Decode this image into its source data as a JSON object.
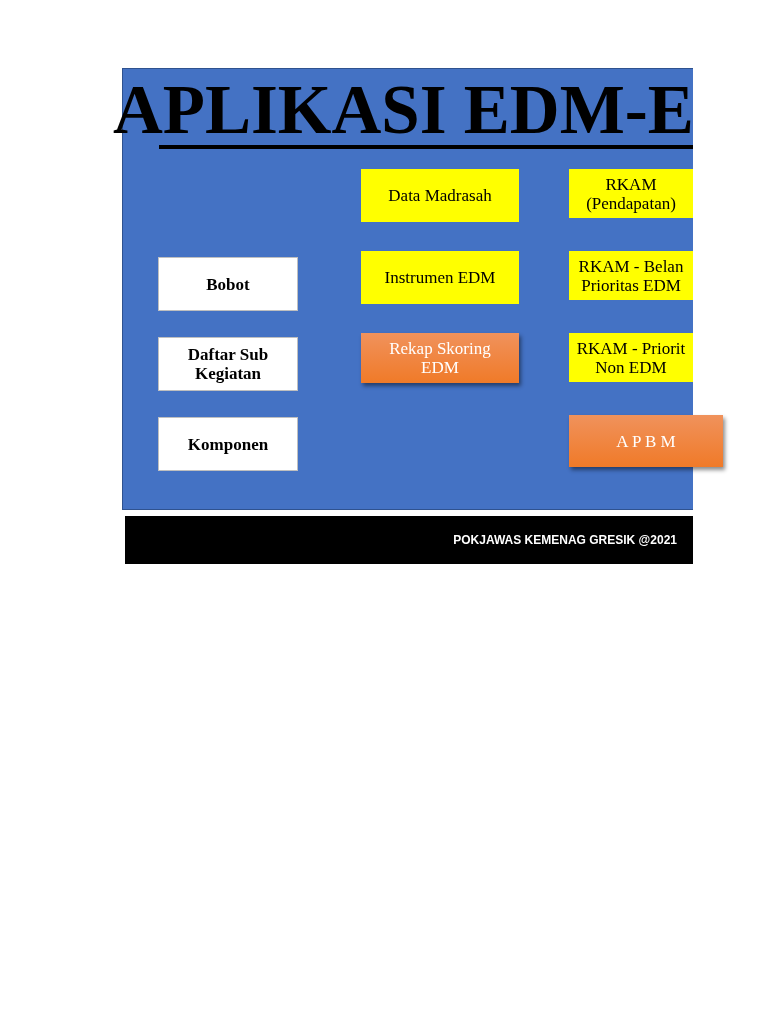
{
  "title": "APLIKASI EDM-E",
  "menu_columns": [
    {
      "items": [
        {
          "label": "Bobot",
          "kind": "plain"
        },
        {
          "label": "Daftar Sub Kegiatan",
          "kind": "plain"
        },
        {
          "label": "Komponen",
          "kind": "plain"
        }
      ]
    },
    {
      "items": [
        {
          "label": "Data Madrasah",
          "kind": "highlight"
        },
        {
          "label": "Instrumen EDM",
          "kind": "highlight"
        },
        {
          "label": "Rekap Skoring EDM",
          "kind": "accent"
        }
      ]
    },
    {
      "items": [
        {
          "label": "RKAM (Pendapatan)",
          "kind": "highlight"
        },
        {
          "label": "RKAM - Belan Prioritas EDM",
          "kind": "highlight"
        },
        {
          "label": "RKAM - Priorit Non EDM",
          "kind": "highlight"
        },
        {
          "label": "A P B M",
          "kind": "accent"
        }
      ]
    }
  ],
  "footer": {
    "text": "POKJAWAS KEMENAG GRESIK @2021"
  }
}
